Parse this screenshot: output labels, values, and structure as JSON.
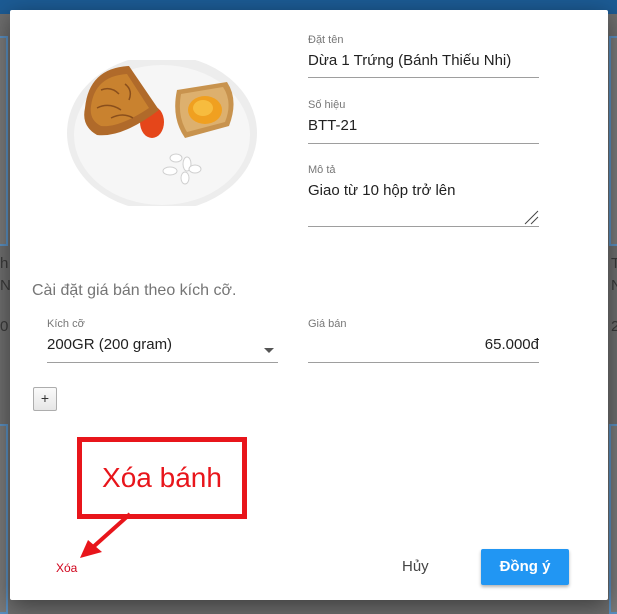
{
  "background": {
    "left_text_1": "h",
    "left_text_2": "N",
    "left_text_3": "0",
    "right_text_1": "T",
    "right_text_2": "N",
    "right_text_3": "2"
  },
  "form": {
    "name_label": "Đặt tên",
    "name_value": "Dừa 1 Trứng (Bánh Thiếu Nhi)",
    "code_label": "Số hiệu",
    "code_value": "BTT-21",
    "desc_label": "Mô tả",
    "desc_value": "Giao từ 10 hộp trở lên"
  },
  "pricing": {
    "section_title": "Cài đặt giá bán theo kích cỡ.",
    "size_label": "Kích cỡ",
    "size_value": "200GR (200 gram)",
    "price_label": "Giá bán",
    "price_value": "65.000đ",
    "add_label": "+"
  },
  "annotation": {
    "callout_text": "Xóa bánh",
    "color": "#e8151b"
  },
  "actions": {
    "delete_label": "Xóa",
    "cancel_label": "Hủy",
    "ok_label": "Đồng ý"
  },
  "colors": {
    "primary": "#2196f3",
    "danger": "#d0021b"
  },
  "image": {
    "icon": "mooncake-photo"
  }
}
